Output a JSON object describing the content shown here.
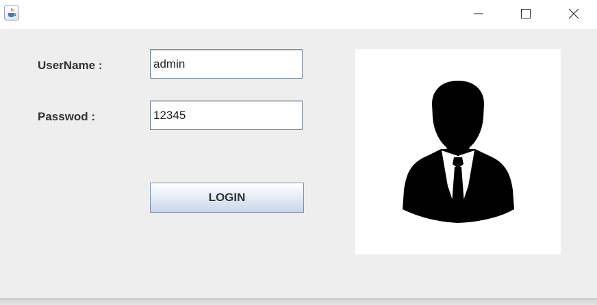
{
  "window": {
    "icons": {
      "app": "java-icon",
      "minimize": "minimize-icon",
      "maximize": "maximize-icon",
      "close": "close-icon"
    }
  },
  "form": {
    "username_label": "UserName :",
    "username_value": "admin",
    "password_label": "Passwod :",
    "password_value": "12345",
    "login_button": "LOGIN"
  },
  "avatar": {
    "icon": "user-avatar-icon"
  },
  "colors": {
    "titlebar": "#ffffff",
    "background": "#eeeeee",
    "avatar_panel": "#ffffff",
    "silhouette": "#000000"
  }
}
